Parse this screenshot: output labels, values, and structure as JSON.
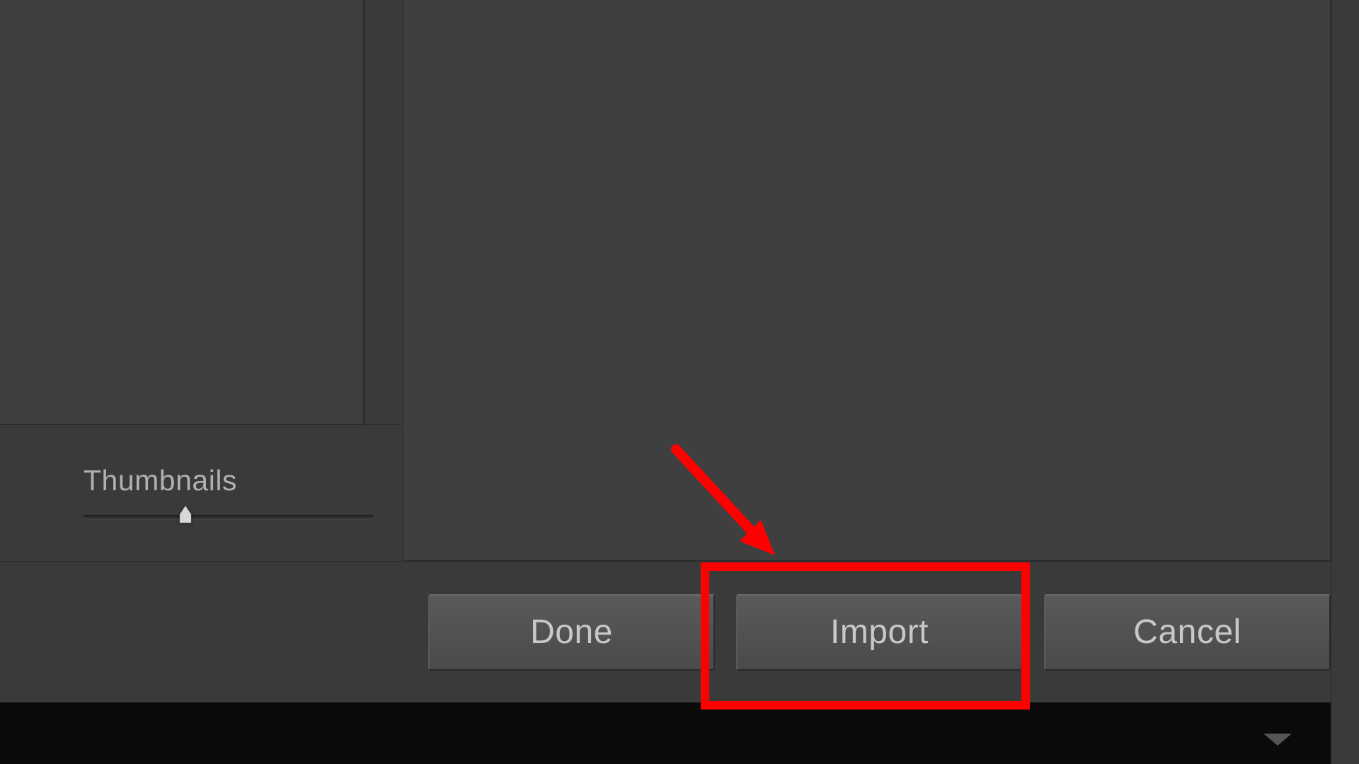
{
  "thumbnails": {
    "label": "Thumbnails"
  },
  "buttons": {
    "done": "Done",
    "import": "Import",
    "cancel": "Cancel"
  },
  "annotation": {
    "highlight_color": "#ff0000",
    "arrow_color": "#ff0000"
  }
}
